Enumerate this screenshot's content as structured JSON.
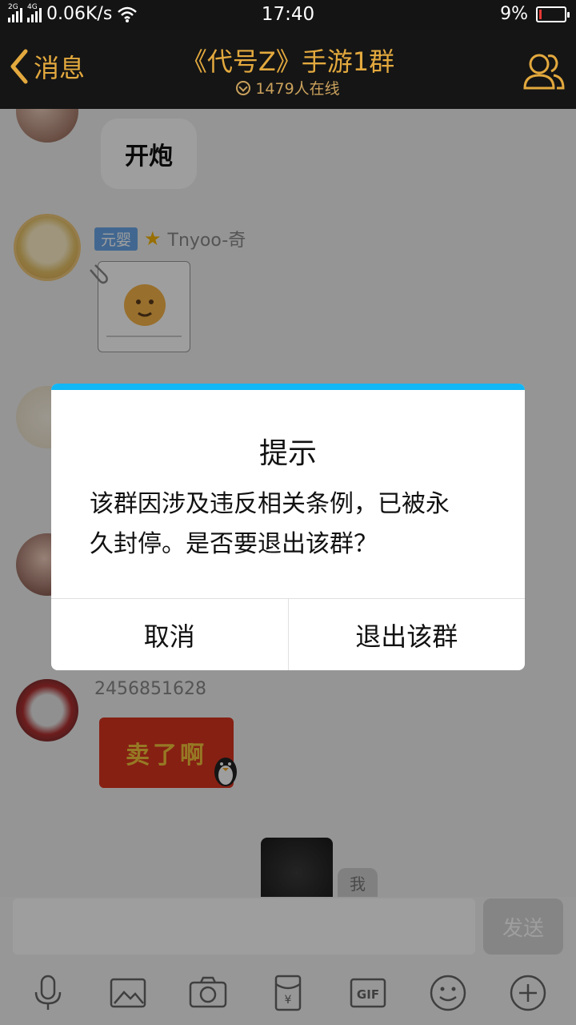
{
  "status_bar": {
    "net_tag_1": "2G",
    "net_tag_2": "4G",
    "speed": "0.06K/s",
    "time": "17:40",
    "battery": "9%",
    "battery_level": 0.09
  },
  "header": {
    "back_label": "消息",
    "title": "《代号Z》手游1群",
    "online": "1479人在线"
  },
  "messages": {
    "m1": {
      "text": "开炮"
    },
    "m2": {
      "rank": "元婴",
      "name": "Tnyoo-奇"
    },
    "m3": {
      "name": "2456851628",
      "sticker_text": "卖了啊"
    },
    "mine_tag": "我"
  },
  "input": {
    "send_label": "发送"
  },
  "toolbar": {
    "gif_label": "GIF",
    "items": [
      "mic-icon",
      "image-icon",
      "camera-icon",
      "red-packet-icon",
      "gif-icon",
      "emoji-icon",
      "plus-icon"
    ]
  },
  "dialog": {
    "title": "提示",
    "message_line1": "该群因涉及违反相关条例，已被永",
    "message_line2": "久封停。是否要退出该群？",
    "cancel_label": "取消",
    "confirm_label": "退出该群",
    "accent_color": "#12b7f5"
  }
}
